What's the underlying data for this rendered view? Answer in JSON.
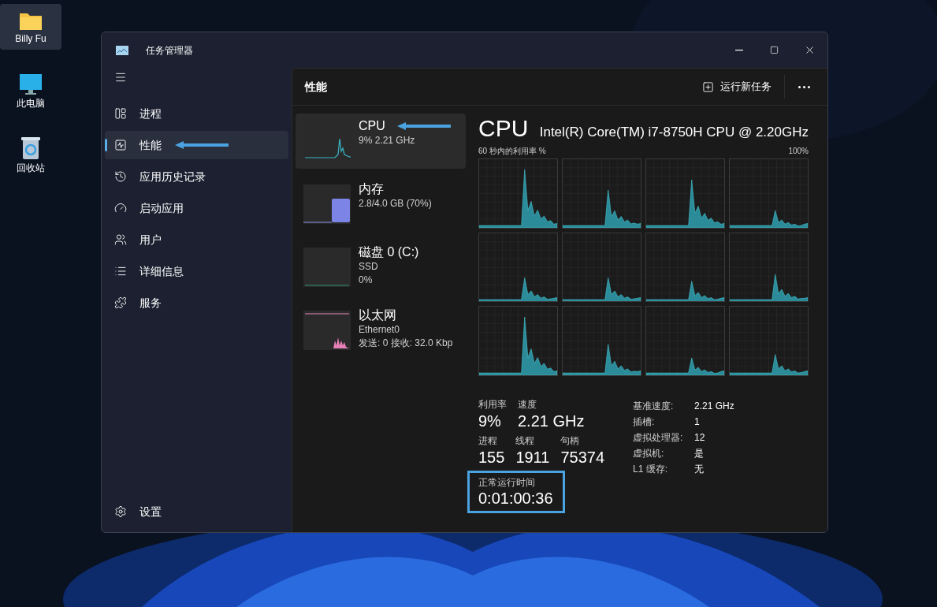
{
  "desktop_icons": [
    {
      "label": "Billy Fu",
      "kind": "folder",
      "selected": true
    },
    {
      "label": "此电脑",
      "kind": "computer",
      "selected": false
    },
    {
      "label": "回收站",
      "kind": "recycle",
      "selected": false
    }
  ],
  "window": {
    "title": "任务管理器"
  },
  "sidebar": {
    "items": [
      {
        "label": "进程",
        "kind": "processes",
        "selected": false
      },
      {
        "label": "性能",
        "kind": "performance",
        "selected": true
      },
      {
        "label": "应用历史记录",
        "kind": "history",
        "selected": false
      },
      {
        "label": "启动应用",
        "kind": "startup",
        "selected": false
      },
      {
        "label": "用户",
        "kind": "users",
        "selected": false
      },
      {
        "label": "详细信息",
        "kind": "details",
        "selected": false
      },
      {
        "label": "服务",
        "kind": "services",
        "selected": false
      }
    ],
    "settings": "设置"
  },
  "header": {
    "title": "性能",
    "run_task": "运行新任务"
  },
  "devices": [
    {
      "kind": "cpu",
      "name": "CPU",
      "lines": [
        "9% 2.21 GHz"
      ],
      "selected": true
    },
    {
      "kind": "memory",
      "name": "内存",
      "lines": [
        "2.8/4.0 GB (70%)"
      ],
      "selected": false
    },
    {
      "kind": "disk",
      "name": "磁盘 0 (C:)",
      "lines": [
        "SSD",
        "0%"
      ],
      "selected": false
    },
    {
      "kind": "ethernet",
      "name": "以太网",
      "lines": [
        "Ethernet0",
        "发送: 0 接收: 32.0 Kbp"
      ],
      "selected": false
    }
  ],
  "detail": {
    "title": "CPU",
    "model": "Intel(R) Core(TM) i7-8750H CPU @ 2.20GHz",
    "graph_label": "60 秒内的利用率 %",
    "graph_max": "100%",
    "stat_rows": [
      [
        {
          "label": "利用率",
          "value": "9%"
        },
        {
          "label": "速度",
          "value": "2.21 GHz"
        }
      ],
      [
        {
          "label": "进程",
          "value": "155"
        },
        {
          "label": "线程",
          "value": "1911"
        },
        {
          "label": "句柄",
          "value": "75374"
        }
      ]
    ],
    "uptime": {
      "label": "正常运行时间",
      "value": "0:01:00:36",
      "highlighted": true
    },
    "specs": [
      {
        "label": "基准速度:",
        "value": "2.21 GHz"
      },
      {
        "label": "插槽:",
        "value": "1"
      },
      {
        "label": "虚拟处理器:",
        "value": "12"
      },
      {
        "label": "虚拟机:",
        "value": "是"
      },
      {
        "label": "L1 缓存:",
        "value": "无"
      }
    ]
  }
}
